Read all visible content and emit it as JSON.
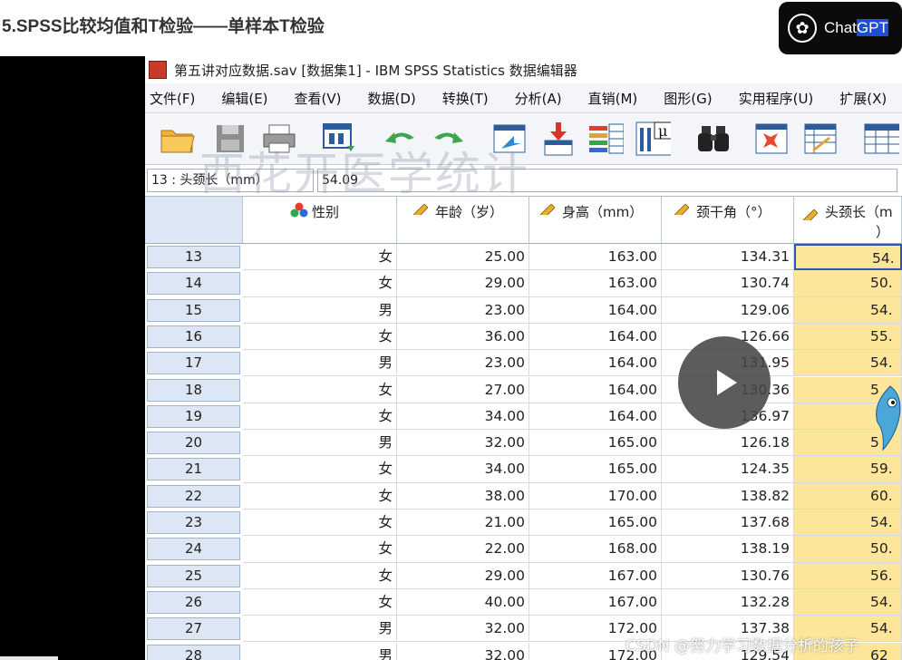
{
  "page": {
    "title": "5.SPSS比较均值和T检验——单样本T检验"
  },
  "badge": {
    "label_a": "Chat",
    "label_b": "GPT"
  },
  "spss": {
    "window_title": "第五讲对应数据.sav [数据集1] - IBM SPSS Statistics 数据编辑器",
    "menu": [
      "文件(F)",
      "编辑(E)",
      "查看(V)",
      "数据(D)",
      "转换(T)",
      "分析(A)",
      "直销(M)",
      "图形(G)",
      "实用程序(U)",
      "扩展(X)"
    ],
    "toolbar_icons": [
      "open-folder-icon",
      "save-icon",
      "print-icon",
      "recall-dialog-icon",
      "undo-icon",
      "redo-icon",
      "goto-case-icon",
      "goto-variable-icon",
      "variables-icon",
      "run-descriptives-icon",
      "find-icon",
      "insert-cases-icon",
      "insert-variable-icon",
      "split-file-icon"
    ],
    "cell_ref": "13 : 头颈长（mm）",
    "cell_value": "54.09",
    "columns": [
      {
        "label": "性别",
        "icon": "nominal-icon"
      },
      {
        "label": "年龄（岁）",
        "icon": "scale-icon"
      },
      {
        "label": "身高（mm）",
        "icon": "scale-icon"
      },
      {
        "label": "颈干角（°）",
        "icon": "scale-icon"
      },
      {
        "label": "头颈长（m",
        "label2": "）",
        "icon": "scale-icon"
      }
    ],
    "rows": [
      {
        "n": "13",
        "c": [
          "女",
          "25.00",
          "163.00",
          "134.31",
          "54."
        ]
      },
      {
        "n": "14",
        "c": [
          "女",
          "29.00",
          "163.00",
          "130.74",
          "50."
        ]
      },
      {
        "n": "15",
        "c": [
          "男",
          "23.00",
          "164.00",
          "129.06",
          "54."
        ]
      },
      {
        "n": "16",
        "c": [
          "女",
          "36.00",
          "164.00",
          "126.66",
          "55."
        ]
      },
      {
        "n": "17",
        "c": [
          "男",
          "23.00",
          "164.00",
          "131.95",
          "54."
        ]
      },
      {
        "n": "18",
        "c": [
          "女",
          "27.00",
          "164.00",
          "130.36",
          "5"
        ]
      },
      {
        "n": "19",
        "c": [
          "女",
          "34.00",
          "164.00",
          "136.97",
          ""
        ]
      },
      {
        "n": "20",
        "c": [
          "男",
          "32.00",
          "165.00",
          "126.18",
          "5"
        ]
      },
      {
        "n": "21",
        "c": [
          "女",
          "34.00",
          "165.00",
          "124.35",
          "59."
        ]
      },
      {
        "n": "22",
        "c": [
          "女",
          "38.00",
          "170.00",
          "138.82",
          "60."
        ]
      },
      {
        "n": "23",
        "c": [
          "女",
          "21.00",
          "165.00",
          "137.68",
          "54."
        ]
      },
      {
        "n": "24",
        "c": [
          "女",
          "22.00",
          "168.00",
          "138.19",
          "50."
        ]
      },
      {
        "n": "25",
        "c": [
          "女",
          "29.00",
          "167.00",
          "130.76",
          "56."
        ]
      },
      {
        "n": "26",
        "c": [
          "女",
          "40.00",
          "167.00",
          "132.28",
          "54."
        ]
      },
      {
        "n": "27",
        "c": [
          "男",
          "32.00",
          "172.00",
          "137.38",
          "54."
        ]
      },
      {
        "n": "28",
        "c": [
          "男",
          "32.00",
          "172.00",
          "129.54",
          "62"
        ]
      }
    ]
  },
  "watermark": "西花开医学统计",
  "csdn": "CSDN @努力学习数据分析的孩子",
  "colors": {
    "highlight": "#fde59a",
    "header_blue": "#dce6f4",
    "badge_bg": "#0b0b0b"
  }
}
